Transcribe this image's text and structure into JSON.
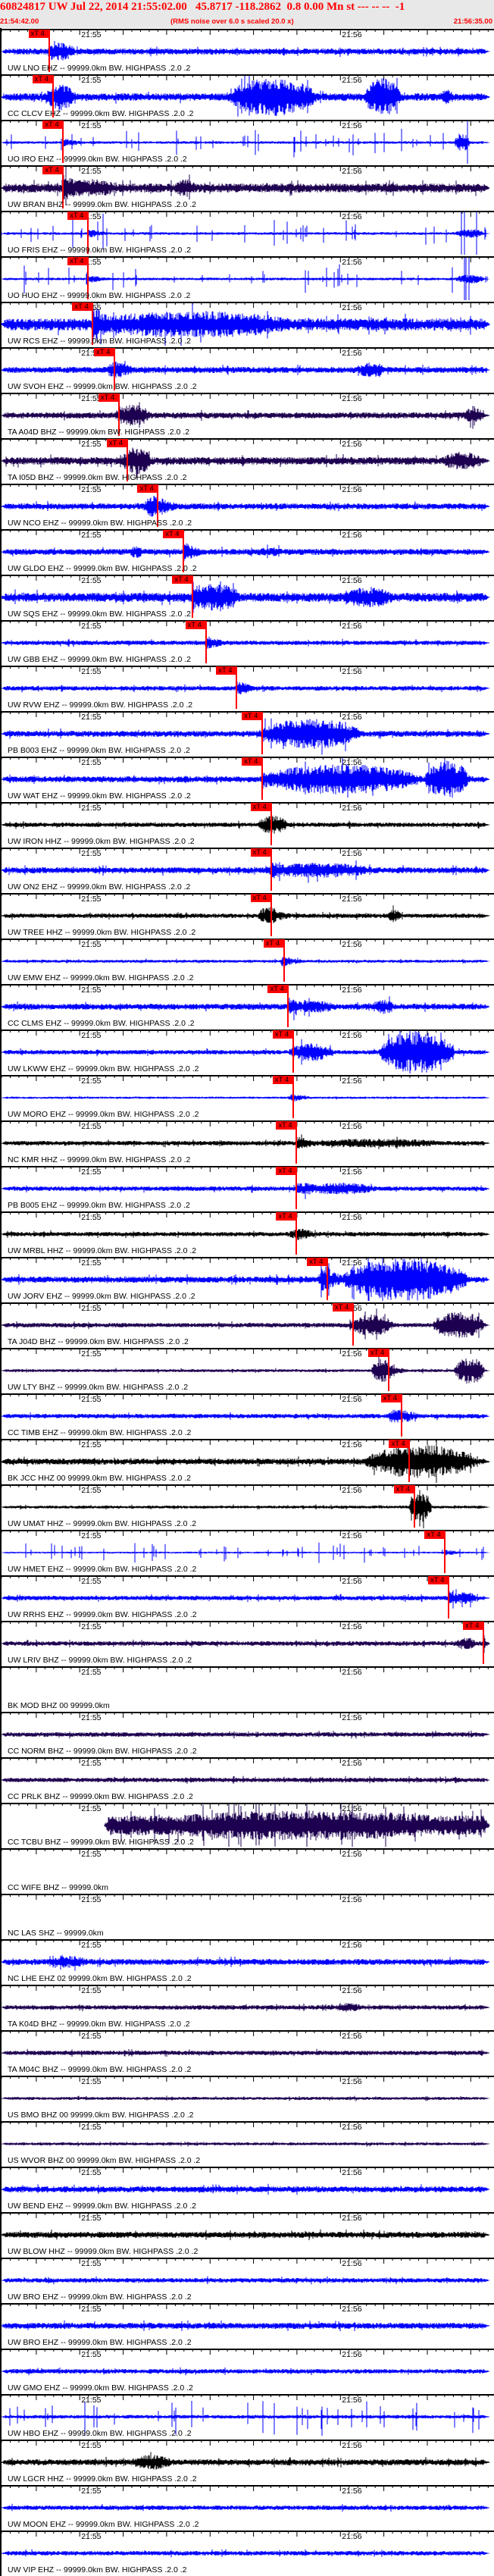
{
  "header": {
    "title": "60824817 UW Jul 22, 2014 21:55:02.00   45.8717 -118.2862  0.8 0.00 Mn st --- -- --  -1",
    "start_time": "21:54:42.00",
    "note": "(RMS noise over 6.0 s scaled 20.0 x)",
    "end_time": "21:56:35.00"
  },
  "time_axis": {
    "window_seconds": 113,
    "tick_labels": [
      {
        "label": "21:55",
        "t": 18
      },
      {
        "label": "21:56",
        "t": 78
      }
    ]
  },
  "pick_label": "xT 4",
  "colors": {
    "blue": "#0000ff",
    "purple": "#1e0050",
    "black": "#000000",
    "pick": "#ff0000",
    "header_text": "#ff0000"
  },
  "stations": [
    {
      "label": "UW LNO EHZ -- 99999.0km BW. HIGHPASS .2.0 .2",
      "color": "blue",
      "pick_s": 10.9
    },
    {
      "label": "CC CLCV EHZ -- 99999.0km BW. HIGHPASS .2.0 .2",
      "color": "blue",
      "pick_s": 11.8
    },
    {
      "label": "UO IRO EHZ -- 99999.0km BW. HIGHPASS .2.0 .2",
      "color": "blue",
      "pick_s": 14.2
    },
    {
      "label": "UW BRAN BHZ -- 99999.0km BW. HIGHPASS .2.0 .2",
      "color": "purple",
      "pick_s": 14.2
    },
    {
      "label": "UO FRIS EHZ -- 99999.0km BW. HIGHPASS .2.0 .2",
      "color": "blue",
      "pick_s": 19.9
    },
    {
      "label": "UO HUO EHZ -- 99999.0km BW. HIGHPASS .2.0 .2",
      "color": "blue",
      "pick_s": 19.9
    },
    {
      "label": "UW RCS EHZ -- 99999.0km BW. HIGHPASS .2.0 .2",
      "color": "blue",
      "pick_s": 21.0
    },
    {
      "label": "UW SVOH EHZ -- 99999.0km BW. HIGHPASS .2.0 .2",
      "color": "blue",
      "pick_s": 26.0
    },
    {
      "label": "TA A04D BHZ -- 99999.0km BW. HIGHPASS .2.0 .2",
      "color": "purple",
      "pick_s": 27.0
    },
    {
      "label": "TA I05D BHZ -- 99999.0km BW. HIGHPASS .2.0 .2",
      "color": "purple",
      "pick_s": 28.9
    },
    {
      "label": "UW NCO EHZ -- 99999.0km BW. HIGHPASS .2.0 .2",
      "color": "blue",
      "pick_s": 36.0
    },
    {
      "label": "UW GLDO EHZ -- 99999.0km BW. HIGHPASS .2.0 .2",
      "color": "blue",
      "pick_s": 41.9
    },
    {
      "label": "UW SQS EHZ -- 99999.0km BW. HIGHPASS .2.0 .2",
      "color": "blue",
      "pick_s": 44.0
    },
    {
      "label": "UW GBB EHZ -- 99999.0km BW. HIGHPASS .2.0 .2",
      "color": "blue",
      "pick_s": 47.0
    },
    {
      "label": "UW RVW EHZ -- 99999.0km BW. HIGHPASS .2.0 .2",
      "color": "blue",
      "pick_s": 54.1
    },
    {
      "label": "PB B003 EHZ -- 99999.0km BW. HIGHPASS .2.0 .2",
      "color": "blue",
      "pick_s": 60.0
    },
    {
      "label": "UW WAT EHZ -- 99999.0km BW. HIGHPASS .2.0 .2",
      "color": "blue",
      "pick_s": 60.0
    },
    {
      "label": "UW IRON HHZ -- 99999.0km BW. HIGHPASS .2.0 .2",
      "color": "black",
      "pick_s": 62.0
    },
    {
      "label": "UW ON2 EHZ -- 99999.0km BW. HIGHPASS .2.0 .2",
      "color": "blue",
      "pick_s": 62.0
    },
    {
      "label": "UW TREE HHZ -- 99999.0km BW. HIGHPASS .2.0 .2",
      "color": "black",
      "pick_s": 62.0
    },
    {
      "label": "UW EMW EHZ -- 99999.0km BW. HIGHPASS .2.0 .2",
      "color": "blue",
      "pick_s": 65.0
    },
    {
      "label": "CC CLMS EHZ -- 99999.0km BW. HIGHPASS .2.0 .2",
      "color": "blue",
      "pick_s": 66.0
    },
    {
      "label": "UW LKWW EHZ -- 99999.0km BW. HIGHPASS .2.0 .2",
      "color": "blue",
      "pick_s": 67.1
    },
    {
      "label": "UW MORO EHZ -- 99999.0km BW. HIGHPASS .2.0 .2",
      "color": "blue",
      "pick_s": 67.1
    },
    {
      "label": "NC KMR HHZ -- 99999.0km BW. HIGHPASS .2.0 .2",
      "color": "black",
      "pick_s": 67.9
    },
    {
      "label": "PB B005 EHZ -- 99999.0km BW. HIGHPASS .2.0 .2",
      "color": "blue",
      "pick_s": 67.9
    },
    {
      "label": "UW MRBL HHZ -- 99999.0km BW. HIGHPASS .2.0 .2",
      "color": "black",
      "pick_s": 67.9
    },
    {
      "label": "UW JORV EHZ -- 99999.0km BW. HIGHPASS .2.0 .2",
      "color": "blue",
      "pick_s": 75.0
    },
    {
      "label": "TA J04D BHZ -- 99999.0km BW. HIGHPASS .2.0 .2",
      "color": "purple",
      "pick_s": 80.9
    },
    {
      "label": "UW LTY BHZ -- 99999.0km BW. HIGHPASS .2.0 .2",
      "color": "purple",
      "pick_s": 89.1
    },
    {
      "label": "CC TIMB EHZ -- 99999.0km BW. HIGHPASS .2.0 .2",
      "color": "blue",
      "pick_s": 92.0
    },
    {
      "label": "BK JCC HHZ 00 99999.0km BW. HIGHPASS .2.0 .2",
      "color": "black",
      "pick_s": 93.9
    },
    {
      "label": "UW UMAT HHZ -- 99999.0km BW. HIGHPASS .2.0 .2",
      "color": "black",
      "pick_s": 95.0
    },
    {
      "label": "UW HMET EHZ -- 99999.0km BW. HIGHPASS .2.0 .2",
      "color": "blue",
      "pick_s": 102.1
    },
    {
      "label": "UW RRHS EHZ -- 99999.0km BW. HIGHPASS .2.0 .2",
      "color": "blue",
      "pick_s": 102.9
    },
    {
      "label": "UW LRIV BHZ -- 99999.0km BW. HIGHPASS .2.0 .2",
      "color": "purple",
      "pick_s": 110.9
    },
    {
      "label": "BK MOD BHZ 00 99999.0km",
      "color": "purple",
      "pick_s": null
    },
    {
      "label": "CC NORM BHZ -- 99999.0km BW. HIGHPASS .2.0 .2",
      "color": "purple",
      "pick_s": null
    },
    {
      "label": "CC PRLK BHZ -- 99999.0km BW. HIGHPASS .2.0 .2",
      "color": "purple",
      "pick_s": null
    },
    {
      "label": "CC TCBU BHZ -- 99999.0km BW. HIGHPASS .2.0 .2",
      "color": "purple",
      "pick_s": null
    },
    {
      "label": "CC WIFE BHZ -- 99999.0km",
      "color": "purple",
      "pick_s": null
    },
    {
      "label": "NC LAS SHZ -- 99999.0km",
      "color": "blue",
      "pick_s": null
    },
    {
      "label": "NC LHE EHZ 02 99999.0km BW. HIGHPASS .2.0 .2",
      "color": "blue",
      "pick_s": null
    },
    {
      "label": "TA K04D BHZ -- 99999.0km BW. HIGHPASS .2.0 .2",
      "color": "purple",
      "pick_s": null
    },
    {
      "label": "TA M04C BHZ -- 99999.0km BW. HIGHPASS .2.0 .2",
      "color": "purple",
      "pick_s": null
    },
    {
      "label": "US BMO BHZ 00 99999.0km BW. HIGHPASS .2.0 .2",
      "color": "purple",
      "pick_s": null
    },
    {
      "label": "US WVOR BHZ 00 99999.0km BW. HIGHPASS .2.0 .2",
      "color": "purple",
      "pick_s": null
    },
    {
      "label": "UW BEND EHZ -- 99999.0km BW. HIGHPASS .2.0 .2",
      "color": "blue",
      "pick_s": null
    },
    {
      "label": "UW BLOW HHZ -- 99999.0km BW. HIGHPASS .2.0 .2",
      "color": "black",
      "pick_s": null
    },
    {
      "label": "UW BRO EHZ -- 99999.0km BW. HIGHPASS .2.0 .2",
      "color": "blue",
      "pick_s": null
    },
    {
      "label": "UW BRO EHZ -- 99999.0km BW. HIGHPASS .2.0 .2",
      "color": "blue",
      "pick_s": null
    },
    {
      "label": "UW GMO EHZ -- 99999.0km BW. HIGHPASS .2.0 .2",
      "color": "blue",
      "pick_s": null
    },
    {
      "label": "UW HBO EHZ -- 99999.0km BW. HIGHPASS .2.0 .2",
      "color": "blue",
      "pick_s": null
    },
    {
      "label": "UW LGCR HHZ -- 99999.0km BW. HIGHPASS .2.0 .2",
      "color": "black",
      "pick_s": null
    },
    {
      "label": "UW MOON EHZ -- 99999.0km BW. HIGHPASS .2.0 .2",
      "color": "blue",
      "pick_s": null
    },
    {
      "label": "UW VIP EHZ -- 99999.0km BW. HIGHPASS .2.0 .2",
      "color": "blue",
      "pick_s": null
    }
  ]
}
